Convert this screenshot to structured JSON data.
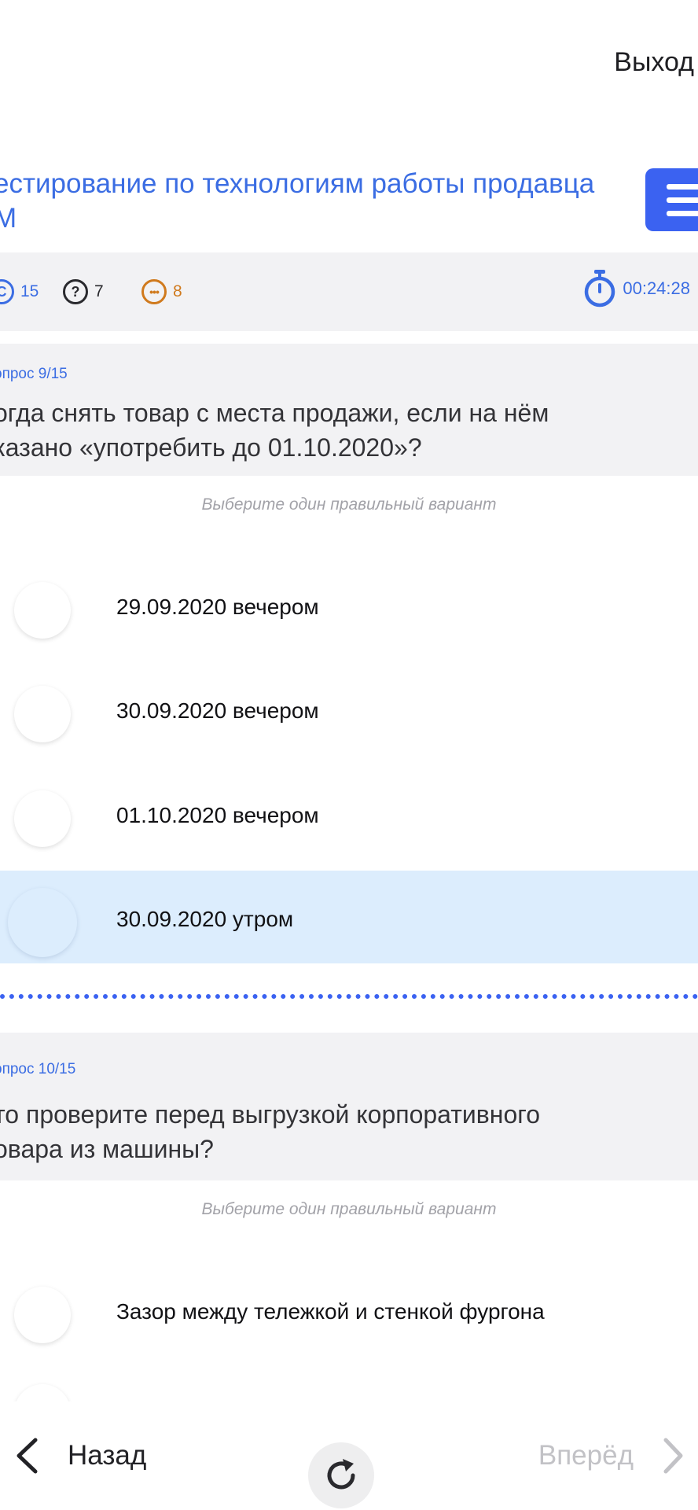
{
  "header": {
    "exit_label": "Выход"
  },
  "test": {
    "title_line1": "естирование по технологиям работы продавца",
    "title_line2": "М"
  },
  "stats": {
    "total": "15",
    "unanswered": "7",
    "skipped": "8",
    "timer": "00:24:28"
  },
  "questions": [
    {
      "number": "опрос 9/15",
      "text_line1": "огда снять товар с места продажи, если на нём",
      "text_line2": "казано «употребить до 01.10.2020»?",
      "hint": "Выберите один правильный вариант",
      "options": [
        {
          "label": "29.09.2020 вечером"
        },
        {
          "label": "30.09.2020 вечером"
        },
        {
          "label": "01.10.2020 вечером"
        },
        {
          "label": "30.09.2020 утром"
        }
      ],
      "selected_option": "30.09.2020 утром"
    },
    {
      "number": "опрос 10/15",
      "text_line1": "то проверите перед выгрузкой корпоративного",
      "text_line2": "овара из машины?",
      "hint": "Выберите один правильный вариант",
      "options": [
        {
          "label": "Зазор между тележкой и стенкой фургона"
        }
      ]
    }
  ],
  "nav": {
    "back_label": "Назад",
    "forward_label": "Вперёд"
  },
  "colors": {
    "accent": "#3b62f1",
    "link": "#3b6de3",
    "skipped": "#d07a1d",
    "selected_bg": "#dcedfd"
  }
}
